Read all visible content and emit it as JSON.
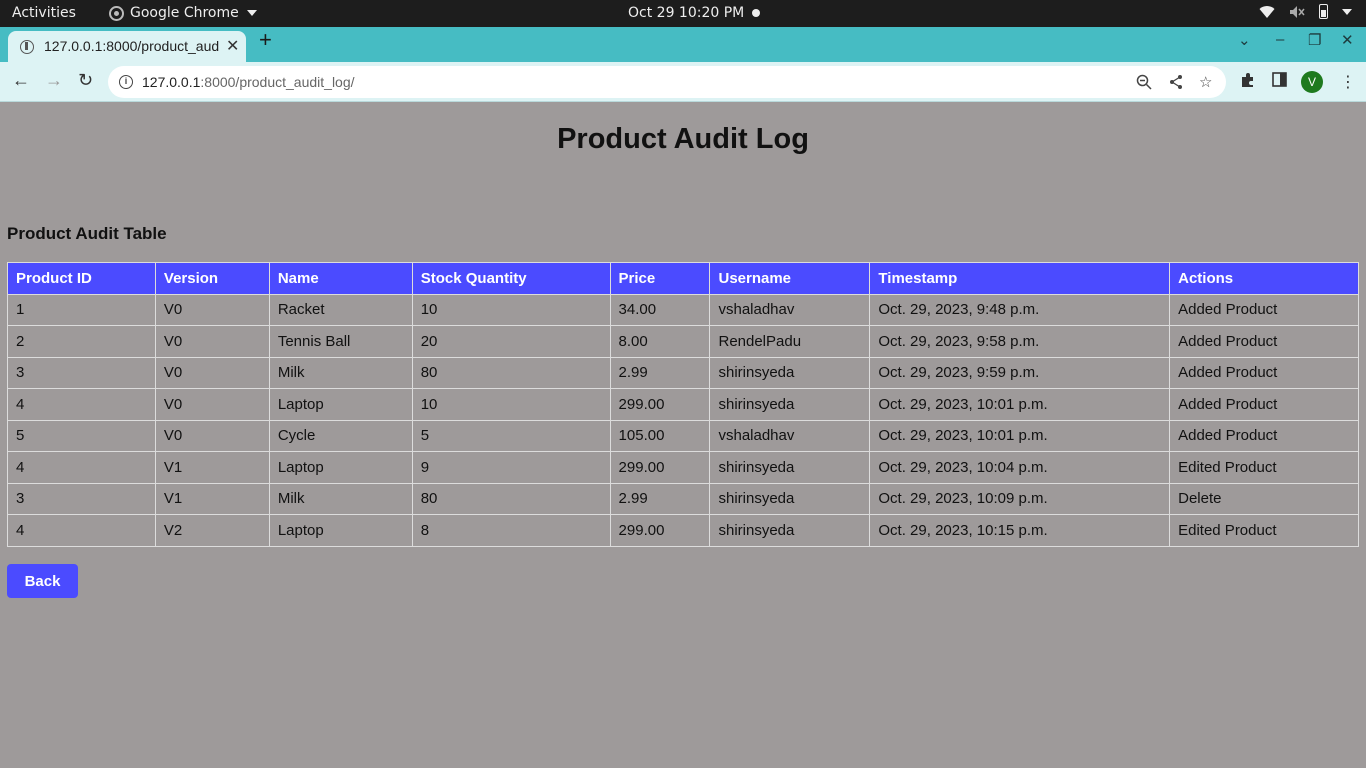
{
  "system_bar": {
    "activities": "Activities",
    "app_name": "Google Chrome",
    "clock": "Oct 29  10:20 PM"
  },
  "browser": {
    "tab_title": "127.0.0.1:8000/product_audit_log/",
    "url_host": "127.0.0.1",
    "url_rest": ":8000/product_audit_log/",
    "profile_initial": "V"
  },
  "page": {
    "title": "Product Audit Log",
    "table_title": "Product Audit Table",
    "back_label": "Back"
  },
  "table": {
    "headers": [
      "Product ID",
      "Version",
      "Name",
      "Stock Quantity",
      "Price",
      "Username",
      "Timestamp",
      "Actions"
    ],
    "rows": [
      [
        "1",
        "V0",
        "Racket",
        "10",
        "34.00",
        "vshaladhav",
        "Oct. 29, 2023, 9:48 p.m.",
        "Added Product"
      ],
      [
        "2",
        "V0",
        "Tennis Ball",
        "20",
        "8.00",
        "RendelPadu",
        "Oct. 29, 2023, 9:58 p.m.",
        "Added Product"
      ],
      [
        "3",
        "V0",
        "Milk",
        "80",
        "2.99",
        "shirinsyeda",
        "Oct. 29, 2023, 9:59 p.m.",
        "Added Product"
      ],
      [
        "4",
        "V0",
        "Laptop",
        "10",
        "299.00",
        "shirinsyeda",
        "Oct. 29, 2023, 10:01 p.m.",
        "Added Product"
      ],
      [
        "5",
        "V0",
        "Cycle",
        "5",
        "105.00",
        "vshaladhav",
        "Oct. 29, 2023, 10:01 p.m.",
        "Added Product"
      ],
      [
        "4",
        "V1",
        "Laptop",
        "9",
        "299.00",
        "shirinsyeda",
        "Oct. 29, 2023, 10:04 p.m.",
        "Edited Product"
      ],
      [
        "3",
        "V1",
        "Milk",
        "80",
        "2.99",
        "shirinsyeda",
        "Oct. 29, 2023, 10:09 p.m.",
        "Delete"
      ],
      [
        "4",
        "V2",
        "Laptop",
        "8",
        "299.00",
        "shirinsyeda",
        "Oct. 29, 2023, 10:15 p.m.",
        "Edited Product"
      ]
    ]
  },
  "colors": {
    "accent": "#4b4bff",
    "page_bg": "#9e9a9a",
    "tabstrip": "#46bcc3"
  }
}
